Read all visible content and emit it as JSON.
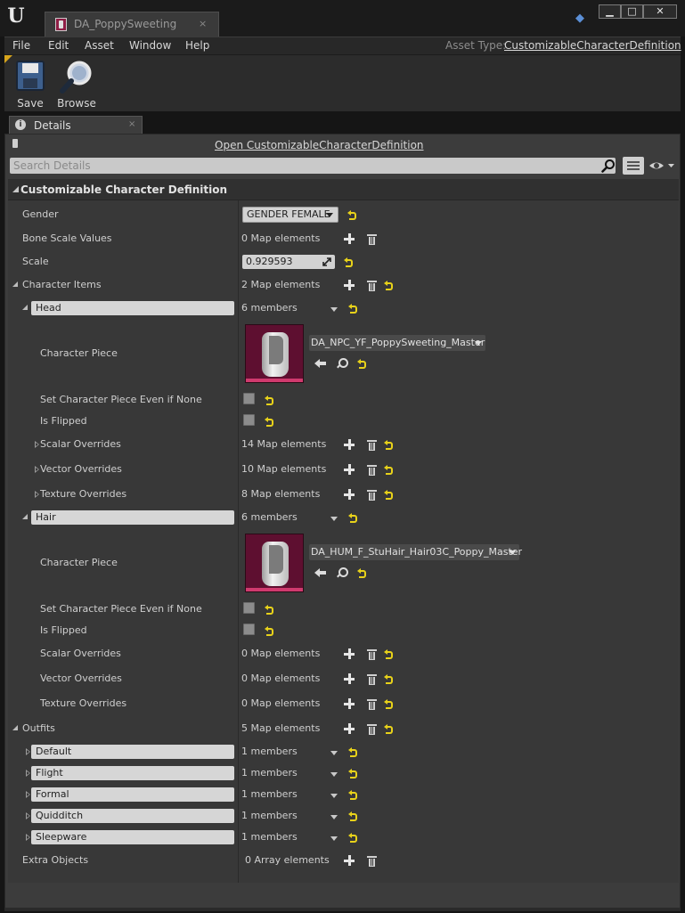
{
  "window": {
    "tab_title": "DA_PoppySweeting",
    "tab_close": "×",
    "btn_minimize": "▁",
    "btn_maximize": "□",
    "btn_close": "✕"
  },
  "menu": {
    "items": [
      "File",
      "Edit",
      "Asset",
      "Window",
      "Help"
    ],
    "asset_type_label": "Asset Type:",
    "asset_type_value": "CustomizableCharacterDefinition"
  },
  "toolbar": {
    "save_label": "Save",
    "browse_label": "Browse"
  },
  "details": {
    "tab_label": "Details",
    "tab_close": "×",
    "open_link": "Open CustomizableCharacterDefinition",
    "search_placeholder": "Search Details",
    "category": "Customizable Character Definition",
    "gender": {
      "label": "Gender",
      "value": "GENDER FEMALE"
    },
    "bone_scale_values": {
      "label": "Bone Scale Values",
      "value": "0 Map elements"
    },
    "scale": {
      "label": "Scale",
      "value": "0.929593"
    },
    "character_items": {
      "label": "Character Items",
      "value": "2 Map elements",
      "entries": [
        {
          "key": "Head",
          "members": "6 members",
          "character_piece_label": "Character Piece",
          "character_piece_value": "DA_NPC_YF_PoppySweeting_Master",
          "set_if_none_label": "Set Character Piece Even if None",
          "is_flipped_label": "Is Flipped",
          "scalar_label": "Scalar Overrides",
          "scalar_value": "14 Map elements",
          "vector_label": "Vector Overrides",
          "vector_value": "10 Map elements",
          "texture_label": "Texture Overrides",
          "texture_value": "8 Map elements"
        },
        {
          "key": "Hair",
          "members": "6 members",
          "character_piece_label": "Character Piece",
          "character_piece_value": "DA_HUM_F_StuHair_Hair03C_Poppy_Master",
          "set_if_none_label": "Set Character Piece Even if None",
          "is_flipped_label": "Is Flipped",
          "scalar_label": "Scalar Overrides",
          "scalar_value": "0 Map elements",
          "vector_label": "Vector Overrides",
          "vector_value": "0 Map elements",
          "texture_label": "Texture Overrides",
          "texture_value": "0 Map elements"
        }
      ]
    },
    "outfits": {
      "label": "Outfits",
      "value": "5 Map elements",
      "entries": [
        {
          "key": "Default",
          "members": "1 members"
        },
        {
          "key": "Flight",
          "members": "1 members"
        },
        {
          "key": "Formal",
          "members": "1 members"
        },
        {
          "key": "Quidditch",
          "members": "1 members"
        },
        {
          "key": "Sleepware",
          "members": "1 members"
        }
      ]
    },
    "extra_objects": {
      "label": "Extra Objects",
      "value": "0 Array elements"
    }
  },
  "colors": {
    "accent_reset": "#e8d21a",
    "thumbnail_bg": "#5e0f30",
    "thumbnail_stripe": "#d03a6e",
    "toolbar_corner": "#d7a51c"
  }
}
